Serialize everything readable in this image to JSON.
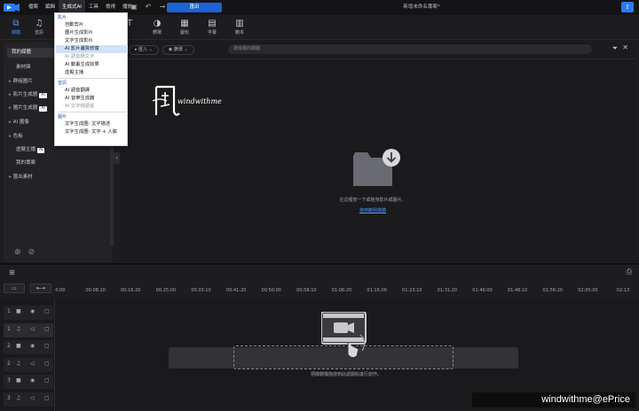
{
  "titlebar": {
    "menu": [
      "檔案",
      "編輯",
      "生成式AI",
      "工具",
      "檢視",
      "播放"
    ],
    "open_menu_index": 2,
    "upload_label": "匯出",
    "project_title": "新增未命名專案*",
    "user_icon": "user-icon"
  },
  "toolbar": {
    "tools": [
      {
        "label": "媒體",
        "icon": "media-icon"
      },
      {
        "label": "音訊",
        "icon": "music-icon"
      },
      {
        "label": "",
        "icon": "title-icon"
      },
      {
        "label": "轉場",
        "icon": "transition-icon"
      },
      {
        "label": "圖包",
        "icon": "effect-icon"
      },
      {
        "label": "字幕",
        "icon": "subtitle-icon"
      },
      {
        "label": "範本",
        "icon": "template-icon"
      }
    ]
  },
  "dropdown": {
    "sections": [
      {
        "title": "影片",
        "items": [
          {
            "label": "自動剪片",
            "highlight": false,
            "disabled": false
          },
          {
            "label": "圖片生成影片",
            "highlight": false,
            "disabled": false
          },
          {
            "label": "文字生成影片",
            "highlight": false,
            "disabled": false
          },
          {
            "label": "AI 影片畫質修復",
            "highlight": true,
            "disabled": false
          },
          {
            "label": "AI 語音轉文字",
            "highlight": false,
            "disabled": true
          },
          {
            "label": "AI 動畫生成效果",
            "highlight": false,
            "disabled": false
          },
          {
            "label": "虛擬主播",
            "highlight": false,
            "disabled": false
          }
        ]
      },
      {
        "title": "音訊",
        "items": [
          {
            "label": "AI 語音翻譯",
            "highlight": false,
            "disabled": false
          },
          {
            "label": "AI 音樂生成器",
            "highlight": false,
            "disabled": false
          },
          {
            "label": "AI 文字轉語音",
            "highlight": false,
            "disabled": true
          }
        ]
      },
      {
        "title": "圖片",
        "items": [
          {
            "label": "文字生成圖: 文字描述",
            "highlight": false,
            "disabled": false
          },
          {
            "label": "文字生成圖: 文字 + 人臉",
            "highlight": false,
            "disabled": false
          }
        ]
      }
    ]
  },
  "sidebar": {
    "items": [
      {
        "label": "我的媒體",
        "selected": true,
        "caret": false,
        "badge": ""
      },
      {
        "label": "素材庫",
        "selected": false,
        "caret": false,
        "badge": ""
      },
      {
        "label": "群組圖片",
        "selected": false,
        "caret": true,
        "badge": ""
      },
      {
        "label": "影片生成器",
        "selected": false,
        "caret": true,
        "badge": "AI"
      },
      {
        "label": "圖片生成器",
        "selected": false,
        "caret": true,
        "badge": "AI"
      },
      {
        "label": "AI 圖像",
        "selected": false,
        "caret": true,
        "badge": ""
      },
      {
        "label": "色板",
        "selected": false,
        "caret": true,
        "badge": ""
      },
      {
        "label": "虛擬主播",
        "selected": false,
        "caret": false,
        "badge": "AI"
      },
      {
        "label": "我的專案",
        "selected": false,
        "caret": false,
        "badge": ""
      },
      {
        "label": "匯出素材",
        "selected": false,
        "caret": true,
        "badge": ""
      }
    ]
  },
  "panel": {
    "filter1": "匯入",
    "filter2": "篩選",
    "search_placeholder": "搜尋我的媒體",
    "logo_text": "windwithme",
    "import_hint": "在這裡按一下或拖曳影片或圖片。",
    "stock_link": "使用範例媒體"
  },
  "timeline": {
    "ticks": [
      "0:00",
      "00:08:10",
      "00:16:20",
      "00:25:00",
      "00:33:10",
      "00:41:20",
      "00:50:00",
      "00:58:10",
      "01:06:20",
      "01:15:00",
      "01:23:10",
      "01:31:20",
      "01:40:00",
      "01:48:10",
      "01:56:20",
      "02:05:00",
      "02:13"
    ],
    "tracks": [
      {
        "num": "1",
        "type": "video-icon"
      },
      {
        "num": "1",
        "type": "audio-icon"
      },
      {
        "num": "2",
        "type": "video-icon"
      },
      {
        "num": "2",
        "type": "audio-icon"
      },
      {
        "num": "3",
        "type": "video-icon"
      },
      {
        "num": "3",
        "type": "audio-icon"
      }
    ],
    "drop_hint": "把媒體檔拖放到此處開始進行創作。"
  },
  "watermark": "windwithme@ePrice",
  "colors": {
    "accent": "#4f95ff",
    "upload": "#1b63d6",
    "menu_highlight": "#cfe2f8"
  }
}
